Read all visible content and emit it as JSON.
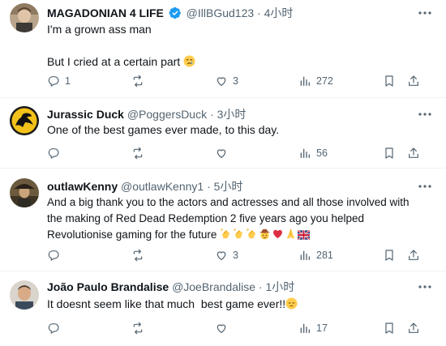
{
  "tweets": [
    {
      "name": "MAGADONIAN 4 LIFE",
      "handle": "@IllBGud123",
      "time": "4小时",
      "verified": true,
      "lines": [
        "I'm a grown ass man",
        "",
        "But I cried at a certain part"
      ],
      "emoji": [
        "crying-face"
      ],
      "replies": "1",
      "reposts": "",
      "likes": "3",
      "views": "272"
    },
    {
      "name": "Jurassic Duck",
      "handle": "@PoggersDuck",
      "time": "3小时",
      "lines": [
        "One of the best games ever made, to this day."
      ],
      "replies": "",
      "reposts": "",
      "likes": "",
      "views": "56"
    },
    {
      "name": "outlawKenny",
      "handle": "@outlawKenny1",
      "time": "5小时",
      "lines": [
        "And a big thank you to the actors and actresses and all those involved with",
        "the making of Red Dead Redemption 2 five years ago you helped",
        "Revolutionise gaming for the future"
      ],
      "emoji": [
        "clapping-hands",
        "clapping-hands",
        "clapping-hands",
        "cowboy-face",
        "red-heart",
        "folded-hands",
        "uk-flag"
      ],
      "replies": "",
      "reposts": "",
      "likes": "3",
      "views": "281"
    },
    {
      "name": "João Paulo Brandalise",
      "handle": "@JoeBrandalise",
      "time": "1小时",
      "lines": [
        "It doesnt seem like that much  best game ever!!"
      ],
      "emoji": [
        "pensive-face"
      ],
      "replies": "",
      "reposts": "",
      "likes": "",
      "views": "17"
    }
  ],
  "separator": "·",
  "accent_color": "#1d9bf0",
  "muted_color": "#536471"
}
